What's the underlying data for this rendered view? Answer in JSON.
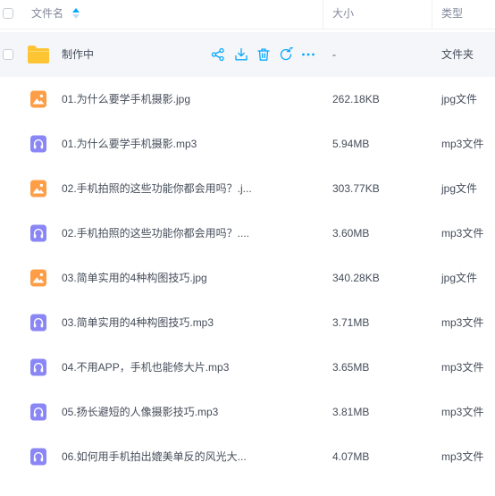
{
  "header": {
    "name_label": "文件名",
    "size_label": "大小",
    "type_label": "类型"
  },
  "colors": {
    "accent": "#06a7ff",
    "folder": "#fdc534",
    "image_icon": "#fd9e47",
    "audio_icon": "#8a86f6"
  },
  "folder_row": {
    "name": "制作中",
    "size": "-",
    "type": "文件夹",
    "actions": [
      "share-icon",
      "download-icon",
      "delete-icon",
      "rename-icon",
      "more-icon"
    ]
  },
  "files": [
    {
      "name": "01.为什么要学手机摄影.jpg",
      "size": "262.18KB",
      "type": "jpg文件",
      "icon": "image-file-icon"
    },
    {
      "name": "01.为什么要学手机摄影.mp3",
      "size": "5.94MB",
      "type": "mp3文件",
      "icon": "audio-file-icon"
    },
    {
      "name": "02.手机拍照的这些功能你都会用吗？.j...",
      "size": "303.77KB",
      "type": "jpg文件",
      "icon": "image-file-icon"
    },
    {
      "name": "02.手机拍照的这些功能你都会用吗？....",
      "size": "3.60MB",
      "type": "mp3文件",
      "icon": "audio-file-icon"
    },
    {
      "name": "03.简单实用的4种构图技巧.jpg",
      "size": "340.28KB",
      "type": "jpg文件",
      "icon": "image-file-icon"
    },
    {
      "name": "03.简单实用的4种构图技巧.mp3",
      "size": "3.71MB",
      "type": "mp3文件",
      "icon": "audio-file-icon"
    },
    {
      "name": "04.不用APP，手机也能修大片.mp3",
      "size": "3.65MB",
      "type": "mp3文件",
      "icon": "audio-file-icon"
    },
    {
      "name": "05.扬长避短的人像摄影技巧.mp3",
      "size": "3.81MB",
      "type": "mp3文件",
      "icon": "audio-file-icon"
    },
    {
      "name": "06.如何用手机拍出媲美单反的风光大...",
      "size": "4.07MB",
      "type": "mp3文件",
      "icon": "audio-file-icon"
    }
  ]
}
